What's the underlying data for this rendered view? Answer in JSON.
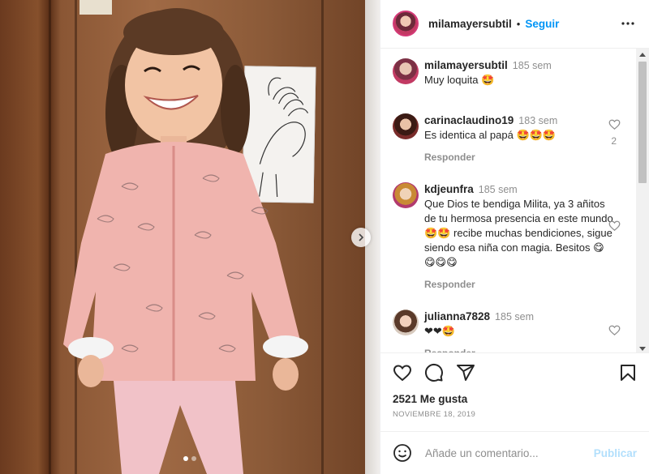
{
  "post": {
    "owner": {
      "username": "milamayersubtil",
      "follow_label": "Seguir"
    },
    "caption": {
      "username": "milamayersubtil",
      "time": "185 sem",
      "text": "Muy loquita 🤩"
    },
    "comments": [
      {
        "username": "carinaclaudino19",
        "time": "183 sem",
        "text": "Es identica al papá 🤩🤩🤩",
        "reply_label": "Responder",
        "likes": "2"
      },
      {
        "username": "kdjeunfra",
        "time": "185 sem",
        "text": "Que Dios te bendiga Milita, ya 3 añitos de tu hermosa presencia en este mundo 🤩🤩 recibe muchas bendiciones, sigue siendo esa niña con magia. Besitos 😋😋😋😋",
        "reply_label": "Responder"
      },
      {
        "username": "julianna7828",
        "time": "185 sem",
        "text": "❤❤🤩",
        "reply_label": "Responder"
      }
    ],
    "likes_text": "2521 Me gusta",
    "date": "NOVIEMBRE 18, 2019",
    "add_comment": {
      "placeholder": "Añade un comentario...",
      "publish_label": "Publicar"
    },
    "carousel": {
      "current": 1,
      "total": 2
    }
  },
  "icons": {
    "more": "more-horizontal-icon",
    "heart": "heart-icon",
    "comment": "comment-icon",
    "share": "send-icon",
    "save": "bookmark-icon",
    "emoji": "emoji-smile-icon",
    "next": "chevron-right-icon"
  },
  "colors": {
    "link": "#0095f6",
    "muted": "#8e8e8e",
    "text": "#262626",
    "publish_disabled": "#b2dffc"
  }
}
